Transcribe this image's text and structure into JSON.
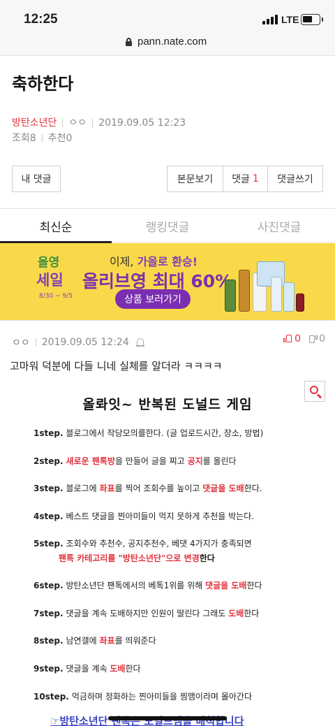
{
  "status": {
    "time": "12:25",
    "network": "LTE"
  },
  "browser": {
    "url": "pann.nate.com"
  },
  "post": {
    "title": "축하한다",
    "category": "방탄소년단",
    "author": "ㅇㅇ",
    "datetime": "2019.09.05 12:23",
    "views_label": "조회",
    "views": "8",
    "likes_label": "추천",
    "likes": "0"
  },
  "actions": {
    "my_comments": "내 댓글",
    "view_post": "본문보기",
    "comments_label": "댓글",
    "comments_count": "1",
    "write_comment": "댓글쓰기"
  },
  "tabs": [
    {
      "label": "최신순",
      "active": true
    },
    {
      "label": "랭킹댓글",
      "active": false
    },
    {
      "label": "사진댓글",
      "active": false
    }
  ],
  "ad": {
    "sale_top": "올영",
    "sale_bottom": "세일",
    "sale_dates": "8/30 ~ 9/5",
    "line1_a": "이제, ",
    "line1_b": "가을로 환승!",
    "line2": "올리브영 최대 60%",
    "cta": "상품 보러가기"
  },
  "comment": {
    "author": "ㅇㅇ",
    "datetime": "2019.09.05 12:24",
    "up": "0",
    "down": "0",
    "text": "고마워 덕분에 다들 니네 실체를 알더라 ㅋㅋㅋㅋ"
  },
  "image_text": {
    "title": "올롸잇~ 반복된 도널드 게임",
    "s1_n": "1step.",
    "s1": "블로그에서 작당모의를한다. (글 업로드시간, 장소, 방법)",
    "s2_n": "2step.",
    "s2_a": "새로운 팬톡방",
    "s2_b": "을 만들어 글을 찌고 ",
    "s2_c": "공지",
    "s2_d": "를 올린다",
    "s3_n": "3step.",
    "s3_a": "블로그에 ",
    "s3_b": "좌표",
    "s3_c": "를 찍어 조회수를 높이고 ",
    "s3_d": "댓글을 도배",
    "s3_e": "한다.",
    "s4_n": "4step.",
    "s4": "베스트 댓글을 찐아미들이 먹지 못하게 추천을 박는다.",
    "s5_n": "5step.",
    "s5": "조회수와 추천수, 공지추천수, 베댓 4가지가 충족되면",
    "s5_sub_a": "팬톡 카테고리를 \"방탄소년단\"으로 변경",
    "s5_sub_b": "한다",
    "s6_n": "6step.",
    "s6_a": "방탄소년단 팬톡에서의 베톡1위를 위해 ",
    "s6_b": "댓글을 도배",
    "s6_c": "한다",
    "s7_n": "7step.",
    "s7_a": "댓글을 계속 도배하지만 인원이 딸린다 그래도 ",
    "s7_b": "도배",
    "s7_c": "한다",
    "s8_n": "8step.",
    "s8_a": "남연갤에 ",
    "s8_b": "좌표",
    "s8_c": "를 띄워준다",
    "s9_n": "9step.",
    "s9_a": "댓글을 계속 ",
    "s9_b": "도배",
    "s9_c": "한다",
    "s10_n": "10step.",
    "s10": "먹금하며 정화하는 찐아미들을 찜맴이라며 몰아간다",
    "footer": "☞방탄소년단 팬톡은 도널드맴을 배척합니다"
  }
}
